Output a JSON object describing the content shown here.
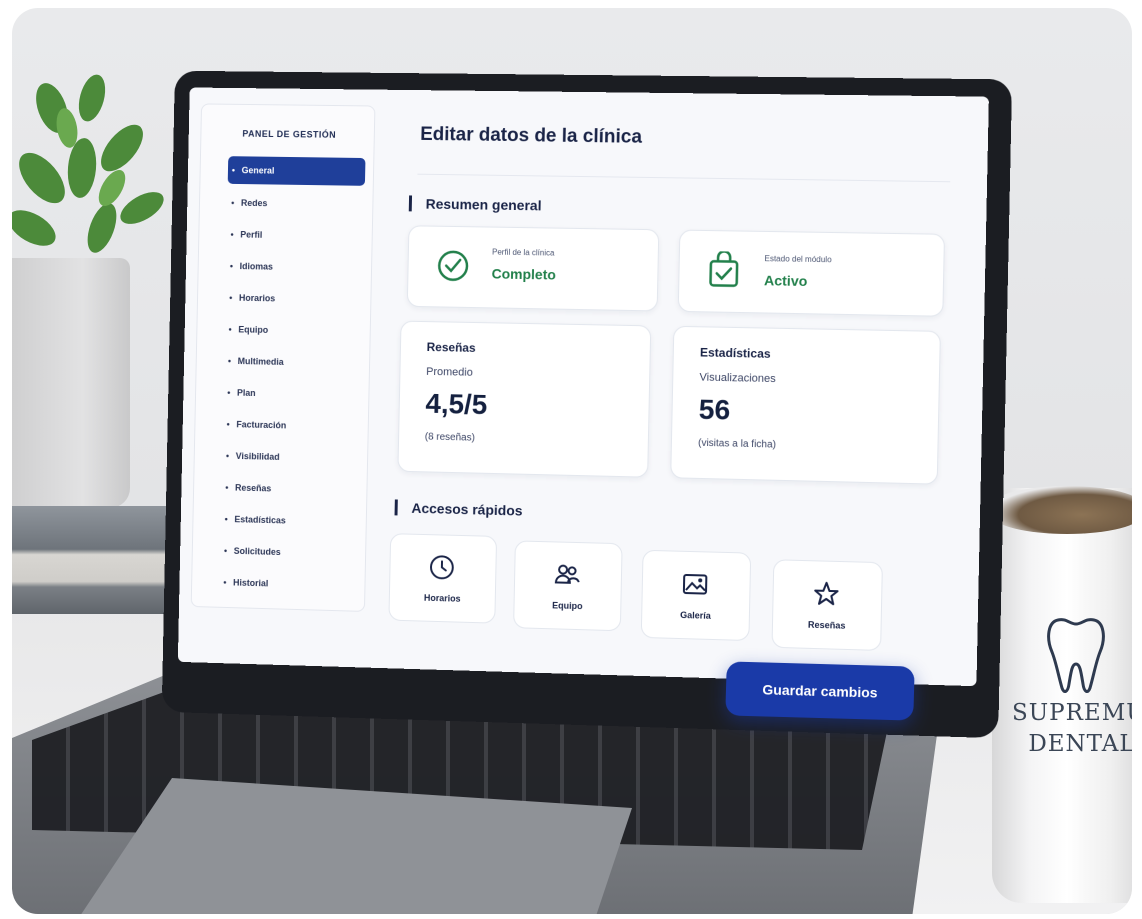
{
  "sidebar": {
    "title": "PANEL DE GESTIÓN",
    "items": [
      {
        "label": "General",
        "active": true
      },
      {
        "label": "Redes"
      },
      {
        "label": "Perfil"
      },
      {
        "label": "Idiomas"
      },
      {
        "label": "Horarios"
      },
      {
        "label": "Equipo"
      },
      {
        "label": "Multimedia"
      },
      {
        "label": "Plan"
      },
      {
        "label": "Facturación"
      },
      {
        "label": "Visibilidad"
      },
      {
        "label": "Reseñas"
      },
      {
        "label": "Estadísticas"
      },
      {
        "label": "Solicitudes"
      },
      {
        "label": "Historial"
      }
    ]
  },
  "main": {
    "title": "Editar datos de la clínica",
    "summary_title": "Resumen general",
    "profile_card": {
      "label": "Perfil de la clínica",
      "value": "Completo",
      "icon": "badge-check-icon"
    },
    "module_card": {
      "label": "Estado del módulo",
      "value": "Activo",
      "icon": "bag-check-icon"
    },
    "reviews_card": {
      "title": "Reseñas",
      "label": "Promedio",
      "value": "4,5/5",
      "note": "(8 reseñas)"
    },
    "stats_card": {
      "title": "Estadísticas",
      "label": "Visualizaciones",
      "value": "56",
      "note": "(visitas a la ficha)"
    },
    "quick_title": "Accesos rápidos",
    "quick_links": [
      {
        "label": "Horarios",
        "icon": "clock-icon"
      },
      {
        "label": "Equipo",
        "icon": "users-icon"
      },
      {
        "label": "Galería",
        "icon": "image-icon"
      },
      {
        "label": "Reseñas",
        "icon": "star-icon"
      }
    ],
    "save_label": "Guardar cambios"
  },
  "mug": {
    "brand_line1": "SUPREMUS",
    "brand_line2": "DENTAL"
  },
  "colors": {
    "primary": "#1f3f9a",
    "success": "#22804b",
    "text": "#1a2447"
  }
}
